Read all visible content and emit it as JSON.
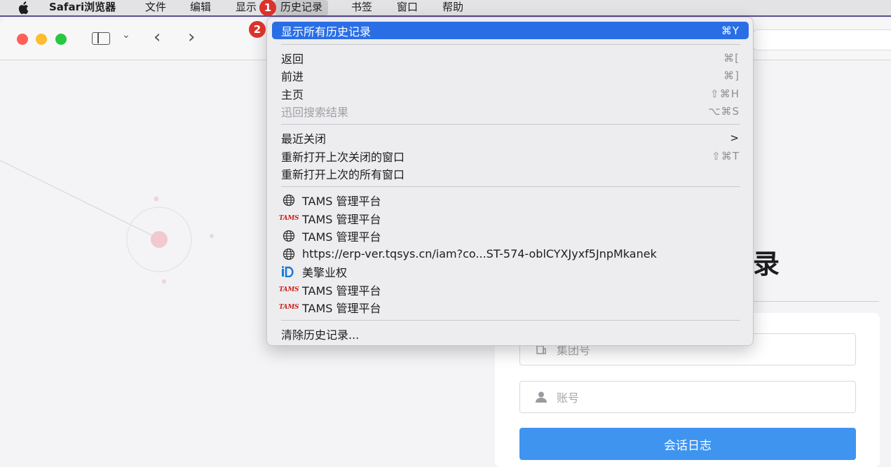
{
  "menubar": {
    "app_name": "Safari浏览器",
    "items": [
      "文件",
      "编辑",
      "显示",
      "历史记录",
      "书签",
      "窗口",
      "帮助"
    ]
  },
  "badges": {
    "first": "1",
    "second": "2"
  },
  "history_menu": {
    "show_all": {
      "label": "显示所有历史记录",
      "shortcut": "⌘Y"
    },
    "back": {
      "label": "返回",
      "shortcut": "⌘["
    },
    "forward": {
      "label": "前进",
      "shortcut": "⌘]"
    },
    "home": {
      "label": "主页",
      "shortcut": "⇧⌘H"
    },
    "snapback": {
      "label": "迅回搜索结果",
      "shortcut": "⌥⌘S"
    },
    "recently_closed": {
      "label": "最近关闭",
      "arrow": ">"
    },
    "reopen_last_closed": {
      "label": "重新打开上次关闭的窗口",
      "shortcut": "⇧⌘T"
    },
    "reopen_all": {
      "label": "重新打开上次的所有窗口"
    },
    "entries": [
      {
        "icon": "globe-icon",
        "label": "TAMS 管理平台"
      },
      {
        "icon": "tams-logo-icon",
        "label": "TAMS 管理平台"
      },
      {
        "icon": "globe-icon",
        "label": "TAMS 管理平台"
      },
      {
        "icon": "globe-icon",
        "label": "https://erp-ver.tqsys.cn/iam?co...ST-574-oblCYXJyxf5JnpMkanek"
      },
      {
        "icon": "id-logo-icon",
        "label": "美擎业权"
      },
      {
        "icon": "tams-logo-icon",
        "label": "TAMS 管理平台"
      },
      {
        "icon": "tams-logo-icon",
        "label": "TAMS 管理平台"
      }
    ],
    "clear": {
      "label": "清除历史记录..."
    }
  },
  "tams_logo_text": "TAMS",
  "page": {
    "title_partial": "录",
    "group_placeholder": "集团号",
    "account_placeholder": "账号",
    "submit_label": "会话日志"
  }
}
